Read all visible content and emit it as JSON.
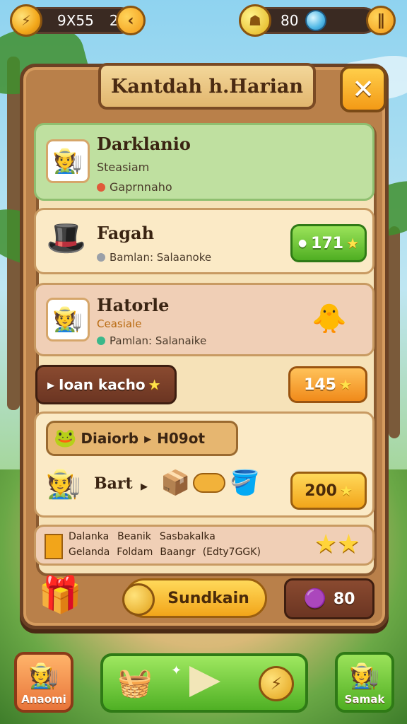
{
  "hud": {
    "coins": "9X55",
    "level": "2",
    "energy": "80"
  },
  "panel": {
    "title": "Kantdah h.Harian"
  },
  "quests": [
    {
      "name": "Darklanio",
      "line1": "Steasiam",
      "line2": "Gaprnnaho"
    },
    {
      "name": "Fagah",
      "line1": "Bamlan: Salaanoke",
      "reward": "171"
    },
    {
      "name": "Hatorle",
      "line1": "Ceasiale",
      "line2": "Pamlan: Salanaike"
    }
  ],
  "actions": {
    "tab_label": "Ioan kacho",
    "tab_reward": "145",
    "combo_label": "Diaiorb",
    "combo_result": "H09ot",
    "craft_label": "Bart",
    "craft_reward": "200"
  },
  "info": {
    "row1": [
      "Dalanka",
      "Beanik",
      "Sasbakalka"
    ],
    "row2": [
      "Gelanda",
      "Foldam",
      "Baangr",
      "(Edty7GGK)"
    ]
  },
  "footer": {
    "claim_label": "Sundkain",
    "gem_count": "80"
  },
  "nav": {
    "left_label": "Anaomi",
    "right_label": "Samak"
  },
  "colors": {
    "panel_wood": "#b9804a",
    "parchment": "#f6e2b8",
    "green_button": "#4fae22",
    "orange_button": "#f08a1a",
    "highlight_card": "#bfe0a0",
    "pink_card": "#f0cfb6"
  }
}
